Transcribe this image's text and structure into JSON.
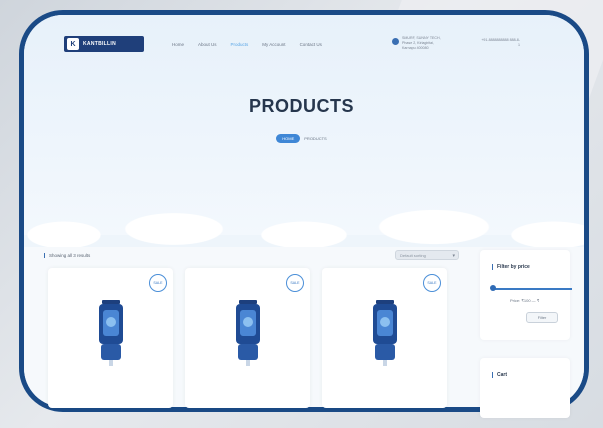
{
  "header": {
    "logo_mark": "K",
    "logo_text": "KANTBILLIN",
    "nav": [
      "Home",
      "About Us",
      "Products",
      "My Account",
      "Contact Us"
    ],
    "active_nav_index": 2,
    "address": "SMURF, SUNNY TECH, Phase 2, Kirlagiritai, Karnapu 400080",
    "phone": "+91-8888888888 888-8-1"
  },
  "hero": {
    "title": "PRODUCTS",
    "breadcrumb": [
      "HOME",
      "PRODUCTS"
    ]
  },
  "shop": {
    "showing_text": "Showing all 3 results",
    "sort_label": "Default sorting",
    "products": [
      {
        "badge": "SALE"
      },
      {
        "badge": "SALE"
      },
      {
        "badge": "SALE"
      }
    ]
  },
  "sidebar": {
    "filter_title": "Filter by price",
    "price_text": "Price: ₹100 — ₹",
    "filter_button": "Filter",
    "cart_title": "Cart"
  },
  "colors": {
    "frame_border": "#1a4a86",
    "accent": "#3f87d6",
    "title": "#26364d"
  }
}
